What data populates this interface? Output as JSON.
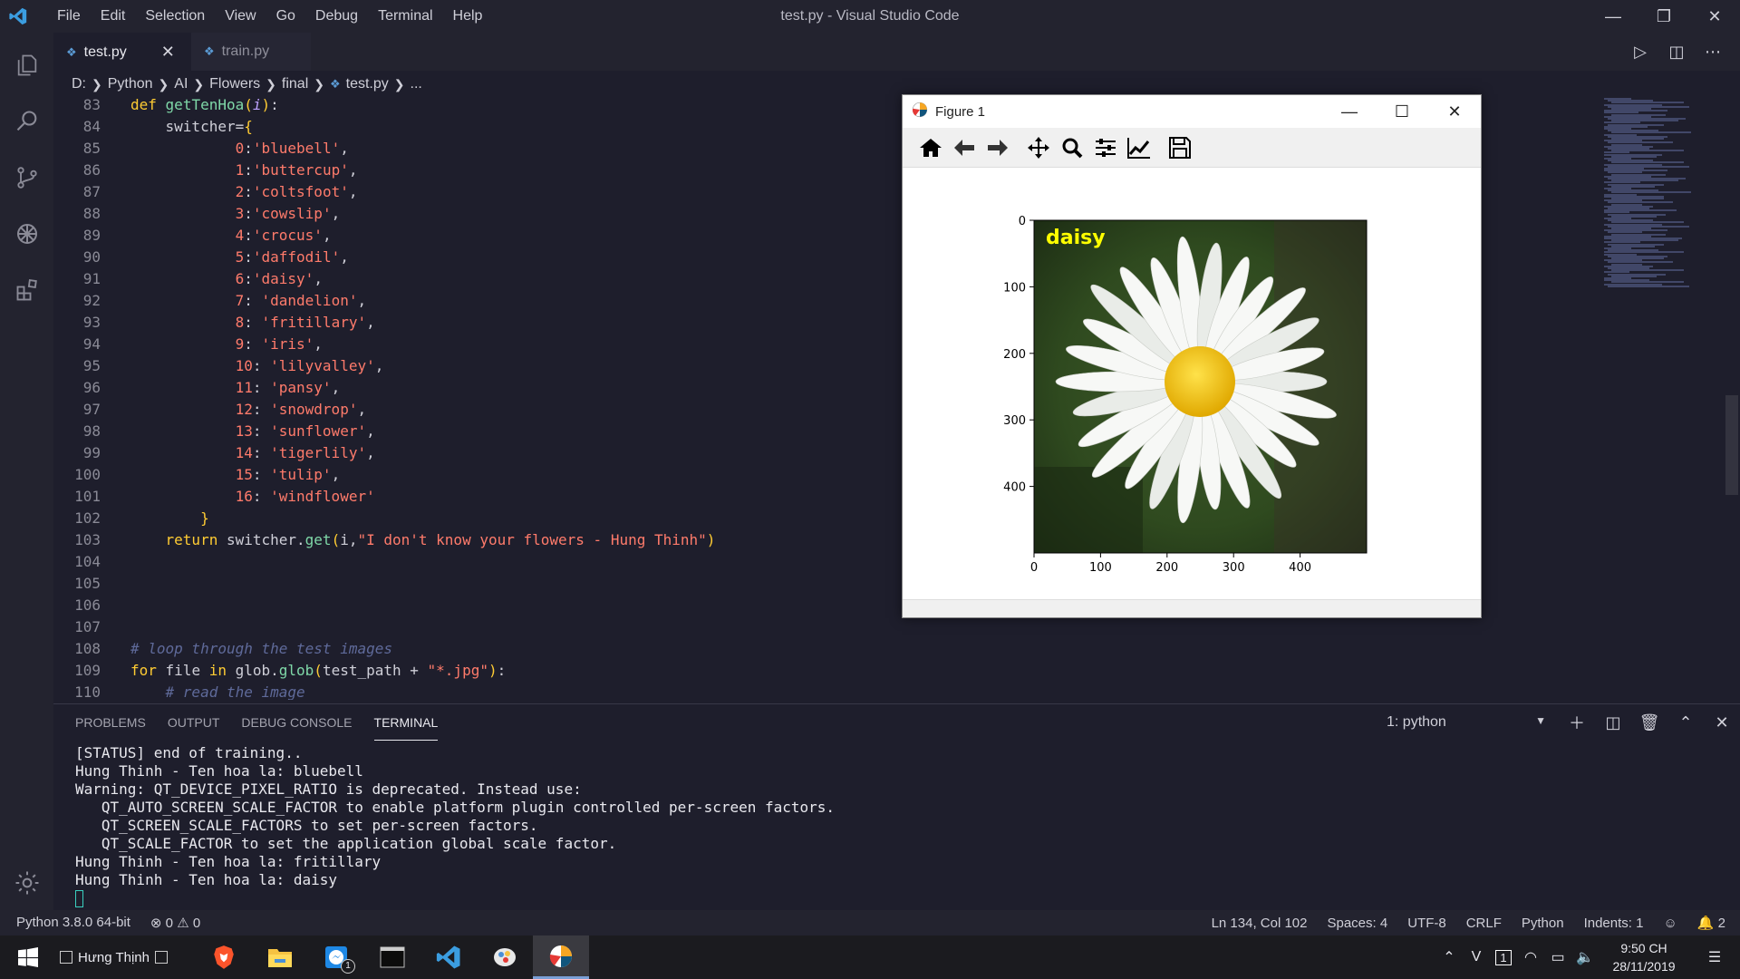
{
  "window": {
    "title": "test.py - Visual Studio Code",
    "menu": [
      "File",
      "Edit",
      "Selection",
      "View",
      "Go",
      "Debug",
      "Terminal",
      "Help"
    ]
  },
  "tabs": [
    {
      "label": "test.py",
      "active": true
    },
    {
      "label": "train.py",
      "active": false
    }
  ],
  "breadcrumb": [
    "D:",
    "Python",
    "AI",
    "Flowers",
    "final",
    "test.py",
    "..."
  ],
  "code": {
    "lines": [
      {
        "n": "83",
        "html": "<span class=\"kw\">def</span> <span class=\"fn\">getTenHoa</span><span class=\"br\">(</span><span class=\"param\">i</span><span class=\"br\">)</span>:"
      },
      {
        "n": "84",
        "html": "    switcher=<span class=\"br\">{</span>"
      },
      {
        "n": "85",
        "html": "            <span class=\"num\">0</span>:<span class=\"str\">'bluebell'</span>,"
      },
      {
        "n": "86",
        "html": "            <span class=\"num\">1</span>:<span class=\"str\">'buttercup'</span>,"
      },
      {
        "n": "87",
        "html": "            <span class=\"num\">2</span>:<span class=\"str\">'coltsfoot'</span>,"
      },
      {
        "n": "88",
        "html": "            <span class=\"num\">3</span>:<span class=\"str\">'cowslip'</span>,"
      },
      {
        "n": "89",
        "html": "            <span class=\"num\">4</span>:<span class=\"str\">'crocus'</span>,"
      },
      {
        "n": "90",
        "html": "            <span class=\"num\">5</span>:<span class=\"str\">'daffodil'</span>,"
      },
      {
        "n": "91",
        "html": "            <span class=\"num\">6</span>:<span class=\"str\">'daisy'</span>,"
      },
      {
        "n": "92",
        "html": "            <span class=\"num\">7</span>: <span class=\"str\">'dandelion'</span>,"
      },
      {
        "n": "93",
        "html": "            <span class=\"num\">8</span>: <span class=\"str\">'fritillary'</span>,"
      },
      {
        "n": "94",
        "html": "            <span class=\"num\">9</span>: <span class=\"str\">'iris'</span>,"
      },
      {
        "n": "95",
        "html": "            <span class=\"num\">10</span>: <span class=\"str\">'lilyvalley'</span>,"
      },
      {
        "n": "96",
        "html": "            <span class=\"num\">11</span>: <span class=\"str\">'pansy'</span>,"
      },
      {
        "n": "97",
        "html": "            <span class=\"num\">12</span>: <span class=\"str\">'snowdrop'</span>,"
      },
      {
        "n": "98",
        "html": "            <span class=\"num\">13</span>: <span class=\"str\">'sunflower'</span>,"
      },
      {
        "n": "99",
        "html": "            <span class=\"num\">14</span>: <span class=\"str\">'tigerlily'</span>,"
      },
      {
        "n": "100",
        "html": "            <span class=\"num\">15</span>: <span class=\"str\">'tulip'</span>,"
      },
      {
        "n": "101",
        "html": "            <span class=\"num\">16</span>: <span class=\"str\">'windflower'</span>"
      },
      {
        "n": "102",
        "html": "        <span class=\"br\">}</span>"
      },
      {
        "n": "103",
        "html": "    <span class=\"kw\">return</span> switcher.<span class=\"fn\">get</span><span class=\"br\">(</span>i,<span class=\"str\">\"I don't know your flowers - Hung Thinh\"</span><span class=\"br\">)</span>"
      },
      {
        "n": "104",
        "html": ""
      },
      {
        "n": "105",
        "html": ""
      },
      {
        "n": "106",
        "html": ""
      },
      {
        "n": "107",
        "html": ""
      },
      {
        "n": "108",
        "html": "<span class=\"cm\"># loop through the test images</span>"
      },
      {
        "n": "109",
        "html": "<span class=\"kw\">for</span> file <span class=\"kw\">in</span> glob.<span class=\"fn\">glob</span><span class=\"br\">(</span>test_path + <span class=\"str\">\"*.jpg\"</span><span class=\"br\">)</span>:"
      },
      {
        "n": "110",
        "html": "    <span class=\"cm\"># read the image</span>"
      }
    ]
  },
  "panel": {
    "tabs": [
      "PROBLEMS",
      "OUTPUT",
      "DEBUG CONSOLE",
      "TERMINAL"
    ],
    "active_tab": "TERMINAL",
    "terminal_select": "1: python",
    "terminal_lines": [
      "[STATUS] end of training..",
      "Hung Thinh - Ten hoa la: bluebell",
      "Warning: QT_DEVICE_PIXEL_RATIO is deprecated. Instead use:",
      "   QT_AUTO_SCREEN_SCALE_FACTOR to enable platform plugin controlled per-screen factors.",
      "   QT_SCREEN_SCALE_FACTORS to set per-screen factors.",
      "   QT_SCALE_FACTOR to set the application global scale factor.",
      "Hung Thinh - Ten hoa la: fritillary",
      "Hung Thinh - Ten hoa la: daisy"
    ]
  },
  "statusbar": {
    "interpreter": "Python 3.8.0 64-bit",
    "errors": "0",
    "warnings": "0",
    "position": "Ln 134, Col 102",
    "spaces": "Spaces: 4",
    "encoding": "UTF-8",
    "eol": "CRLF",
    "language": "Python",
    "indents": "Indents: 1",
    "notifications": "2"
  },
  "taskbar": {
    "user": "Hưng Thịnh",
    "messenger_badge": "1",
    "time": "9:50 CH",
    "date": "28/11/2019",
    "tray_badge": "1"
  },
  "figure": {
    "title": "Figure 1",
    "label": "daisy",
    "image_label_color": "#ffff00",
    "y_ticks": [
      "0",
      "100",
      "200",
      "300",
      "400"
    ],
    "x_ticks": [
      "0",
      "100",
      "200",
      "300",
      "400"
    ]
  },
  "colors": {
    "accent": "#5b9bd5",
    "keyword": "#ffcc33",
    "string": "#ff7b6b",
    "function": "#7fd8a8",
    "comment": "#5f6a9a"
  }
}
